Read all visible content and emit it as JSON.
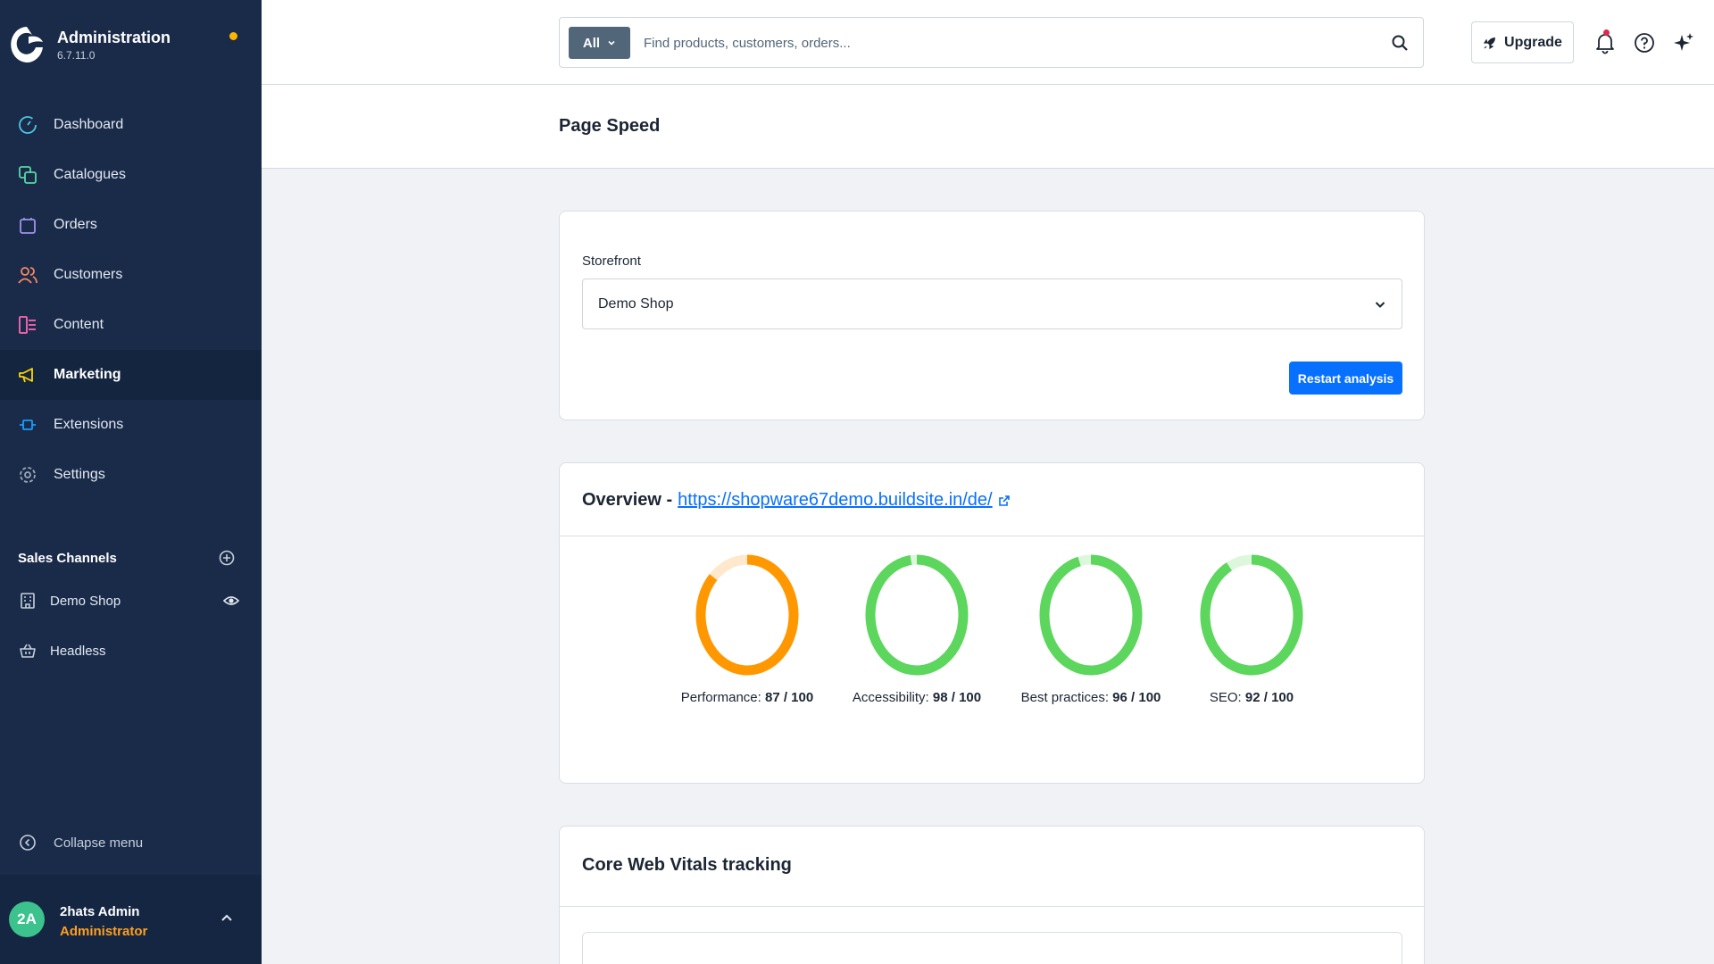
{
  "app": {
    "title": "Administration",
    "version": "6.7.11.0",
    "brand_color": "#1a2b4a",
    "notification_dot_color": "#ffb400"
  },
  "sidebar": {
    "items": [
      {
        "label": "Dashboard",
        "icon": "dashboard-icon",
        "color": "#4ec6e0"
      },
      {
        "label": "Catalogues",
        "icon": "catalogue-icon",
        "color": "#57d9a3"
      },
      {
        "label": "Orders",
        "icon": "orders-icon",
        "color": "#a092f0"
      },
      {
        "label": "Customers",
        "icon": "customers-icon",
        "color": "#f88962"
      },
      {
        "label": "Content",
        "icon": "content-icon",
        "color": "#ff68b4"
      },
      {
        "label": "Marketing",
        "icon": "marketing-icon",
        "color": "#ffd700",
        "active": true
      },
      {
        "label": "Extensions",
        "icon": "extensions-icon",
        "color": "#189eff"
      },
      {
        "label": "Settings",
        "icon": "settings-icon",
        "color": "#9aa8b5"
      }
    ],
    "sales_channels": {
      "title": "Sales Channels",
      "items": [
        {
          "label": "Demo Shop",
          "icon": "storefront-icon"
        },
        {
          "label": "Headless",
          "icon": "basket-icon"
        }
      ]
    },
    "collapse_label": "Collapse menu",
    "user": {
      "initials": "2A",
      "name": "2hats Admin",
      "role": "Administrator"
    }
  },
  "topbar": {
    "search_type": "All",
    "search_placeholder": "Find products, customers, orders...",
    "upgrade_label": "Upgrade"
  },
  "page": {
    "title": "Page Speed"
  },
  "storefront": {
    "label": "Storefront",
    "selected": "Demo Shop",
    "restart_label": "Restart analysis"
  },
  "overview": {
    "title": "Overview -",
    "url": "https://shopware67demo.buildsite.in/de/",
    "scores": [
      {
        "name": "Performance:",
        "score": 87,
        "max": 100,
        "score_text": "87 / 100",
        "color": "#ff9800",
        "track_color": "#ffe8cc"
      },
      {
        "name": "Accessibility:",
        "score": 98,
        "max": 100,
        "score_text": "98 / 100",
        "color": "#5cd65c",
        "track_color": "#ddf7dd"
      },
      {
        "name": "Best practices:",
        "score": 96,
        "max": 100,
        "score_text": "96 / 100",
        "color": "#5cd65c",
        "track_color": "#ddf7dd"
      },
      {
        "name": "SEO:",
        "score": 92,
        "max": 100,
        "score_text": "92 / 100",
        "color": "#5cd65c",
        "track_color": "#ddf7dd"
      }
    ]
  },
  "core_web_vitals": {
    "title": "Core Web Vitals tracking"
  }
}
